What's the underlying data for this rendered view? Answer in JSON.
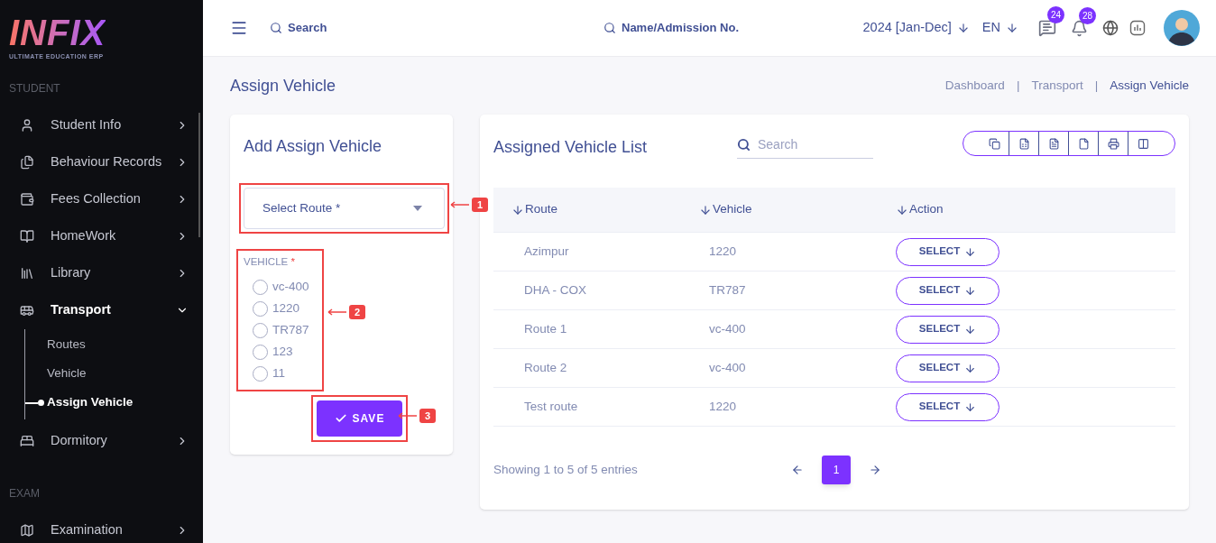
{
  "sidebar": {
    "logo": "INFIX",
    "tagline": "ULTIMATE EDUCATION ERP",
    "sections": [
      {
        "heading": "STUDENT",
        "items": [
          {
            "label": "Student Info",
            "expanded": false
          },
          {
            "label": "Behaviour Records",
            "expanded": false
          },
          {
            "label": "Fees Collection",
            "expanded": false
          },
          {
            "label": "HomeWork",
            "expanded": false
          },
          {
            "label": "Library",
            "expanded": false
          },
          {
            "label": "Transport",
            "expanded": true,
            "children": [
              {
                "label": "Routes",
                "selected": false
              },
              {
                "label": "Vehicle",
                "selected": false
              },
              {
                "label": "Assign Vehicle",
                "selected": true
              }
            ]
          },
          {
            "label": "Dormitory",
            "expanded": false
          }
        ]
      },
      {
        "heading": "EXAM",
        "items": [
          {
            "label": "Examination",
            "expanded": false
          }
        ]
      }
    ]
  },
  "header": {
    "search": {
      "placeholder": "Search"
    },
    "student_search": {
      "placeholder": "Name/Admission No."
    },
    "session": "2024 [Jan-Dec]",
    "language": "EN",
    "message_count": "24",
    "notification_count": "28"
  },
  "page": {
    "title": "Assign Vehicle",
    "breadcrumbs": [
      "Dashboard",
      "Transport",
      "Assign Vehicle"
    ],
    "breadcrumb_separator": "|"
  },
  "form": {
    "title": "Add Assign Vehicle",
    "route_select": {
      "placeholder": "Select Route *"
    },
    "vehicle_label": "VEHICLE",
    "required_mark": "*",
    "vehicles": [
      {
        "label": "vc-400",
        "selected": false
      },
      {
        "label": "1220",
        "selected": false
      },
      {
        "label": "TR787",
        "selected": false
      },
      {
        "label": "123",
        "selected": false
      },
      {
        "label": "11",
        "selected": false
      }
    ],
    "save": "SAVE"
  },
  "list": {
    "title": "Assigned Vehicle List",
    "search": {
      "placeholder": "Search"
    },
    "columns": [
      "Route",
      "Vehicle",
      "Action"
    ],
    "rows": [
      {
        "route": "Azimpur",
        "vehicle": "1220",
        "action": "SELECT"
      },
      {
        "route": "DHA - COX",
        "vehicle": "TR787",
        "action": "SELECT"
      },
      {
        "route": "Route 1",
        "vehicle": "vc-400",
        "action": "SELECT"
      },
      {
        "route": "Route 2",
        "vehicle": "vc-400",
        "action": "SELECT"
      },
      {
        "route": "Test route",
        "vehicle": "1220",
        "action": "SELECT"
      }
    ],
    "info": "Showing 1 to 5 of 5 entries",
    "pages": [
      {
        "label": "1",
        "selected": true
      }
    ]
  },
  "annotations": [
    {
      "number": "1"
    },
    {
      "number": "2"
    },
    {
      "number": "3"
    }
  ]
}
